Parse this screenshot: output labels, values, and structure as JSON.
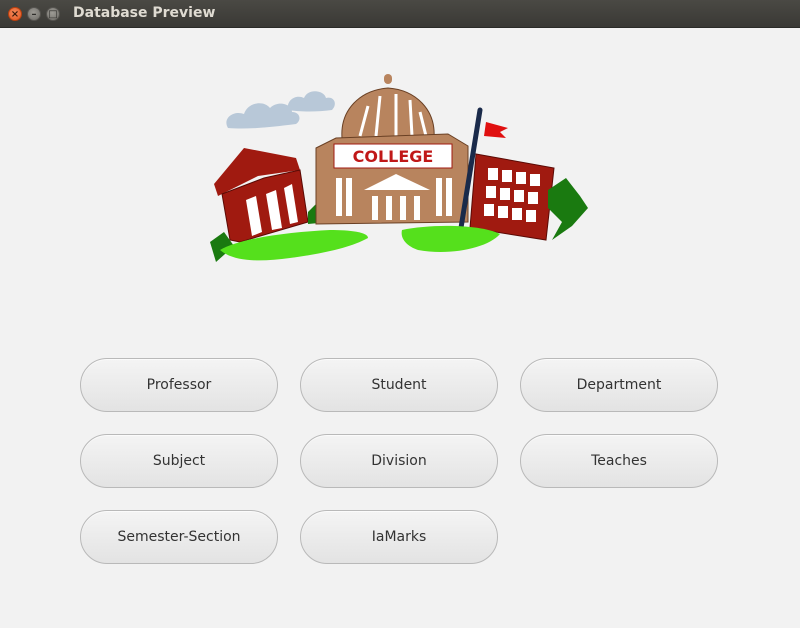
{
  "window": {
    "title": "Database Preview",
    "controls": {
      "close_glyph": "×",
      "minimize_glyph": "–",
      "maximize_glyph": "□"
    }
  },
  "logo": {
    "sign_text": "COLLEGE",
    "colors": {
      "dome": "#b8845e",
      "brick": "#a01a10",
      "grass": "#55e01c",
      "flag": "#e01010",
      "cloud": "#b8c8d8",
      "pole": "#1a2a4a"
    }
  },
  "buttons": [
    {
      "label": "Professor"
    },
    {
      "label": "Student"
    },
    {
      "label": "Department"
    },
    {
      "label": "Subject"
    },
    {
      "label": "Division"
    },
    {
      "label": "Teaches"
    },
    {
      "label": "Semester-Section"
    },
    {
      "label": "IaMarks"
    }
  ]
}
